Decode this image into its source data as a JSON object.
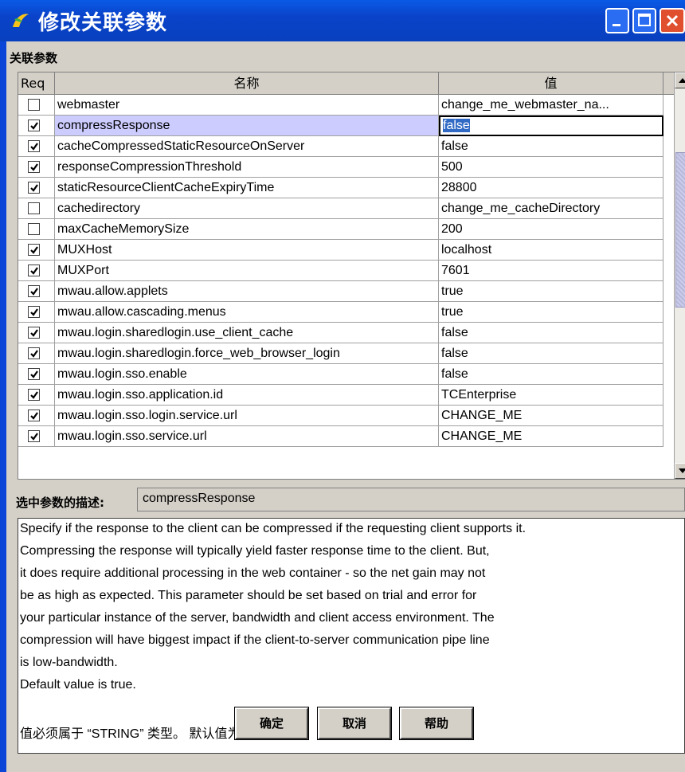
{
  "window": {
    "title": "修改关联参数"
  },
  "section_label": "关联参数",
  "table": {
    "columns": [
      "Req",
      "名称",
      "值"
    ],
    "rows": [
      {
        "req": false,
        "name": "webmaster",
        "value": "change_me_webmaster_na..."
      },
      {
        "req": true,
        "name": "compressResponse",
        "value": "false",
        "selected": true
      },
      {
        "req": true,
        "name": "cacheCompressedStaticResourceOnServer",
        "value": "false"
      },
      {
        "req": true,
        "name": "responseCompressionThreshold",
        "value": "500"
      },
      {
        "req": true,
        "name": "staticResourceClientCacheExpiryTime",
        "value": "28800"
      },
      {
        "req": false,
        "name": "cachedirectory",
        "value": "change_me_cacheDirectory"
      },
      {
        "req": false,
        "name": "maxCacheMemorySize",
        "value": "200"
      },
      {
        "req": true,
        "name": "MUXHost",
        "value": "localhost"
      },
      {
        "req": true,
        "name": "MUXPort",
        "value": "7601"
      },
      {
        "req": true,
        "name": "mwau.allow.applets",
        "value": "true"
      },
      {
        "req": true,
        "name": "mwau.allow.cascading.menus",
        "value": "true"
      },
      {
        "req": true,
        "name": "mwau.login.sharedlogin.use_client_cache",
        "value": "false"
      },
      {
        "req": true,
        "name": "mwau.login.sharedlogin.force_web_browser_login",
        "value": "false"
      },
      {
        "req": true,
        "name": "mwau.login.sso.enable",
        "value": "false"
      },
      {
        "req": true,
        "name": "mwau.login.sso.application.id",
        "value": "TCEnterprise"
      },
      {
        "req": true,
        "name": "mwau.login.sso.login.service.url",
        "value": "CHANGE_ME"
      },
      {
        "req": true,
        "name": "mwau.login.sso.service.url",
        "value": "CHANGE_ME"
      }
    ]
  },
  "description": {
    "label": "选中参数的描述:",
    "selected_name": "compressResponse",
    "lines": [
      "Specify if the response to the client can be compressed if the requesting client supports it.",
      "Compressing the response will typically yield faster response time to the client. But,",
      "it does require additional processing in the web container - so the net gain may not",
      "be as high as expected. This parameter should be set based on trial and error for",
      "your particular instance of the server, bandwidth and client access environment. The",
      "compression will have biggest impact if the client-to-server communication pipe line",
      "is low-bandwidth.",
      "Default value is true.",
      "",
      "值必须属于 “STRING” 类型。 默认值为 “true” 。"
    ]
  },
  "buttons": {
    "ok": "确定",
    "cancel": "取消",
    "help": "帮助"
  }
}
